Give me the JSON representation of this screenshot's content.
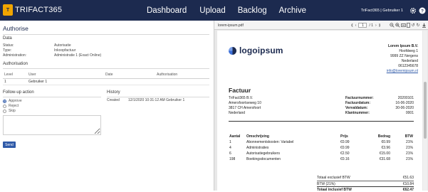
{
  "app": {
    "logo_badge": "T",
    "logo_text": "TRIFACT365"
  },
  "nav": {
    "items": [
      {
        "label": "Dashboard"
      },
      {
        "label": "Upload"
      },
      {
        "label": "Backlog"
      },
      {
        "label": "Archive"
      }
    ]
  },
  "user": {
    "text": "TriFact365 | Gebruiker 1",
    "icons": [
      "gear-icon",
      "help-icon"
    ]
  },
  "page": {
    "title": "Authorise",
    "data_heading": "Data",
    "fields": [
      {
        "label": "Status:",
        "value": "Autorisatie"
      },
      {
        "label": "Type:",
        "value": "Inkoopfactuur"
      },
      {
        "label": "Administration:",
        "value": "Administratie 1 (Exact Online)"
      }
    ],
    "authorisation_heading": "Authorisation",
    "auth_table": {
      "headers": [
        "Level",
        "User",
        "Date",
        "Authorisation"
      ],
      "rows": [
        [
          "1",
          "Gebruiker 1",
          "",
          ""
        ]
      ]
    },
    "follow_up_heading": "Follow-up action",
    "options": [
      {
        "label": "Approve",
        "checked": true
      },
      {
        "label": "Reject",
        "checked": false
      },
      {
        "label": "Skip",
        "checked": false
      }
    ],
    "comment_value": "",
    "send_label": "Send",
    "history_heading": "History",
    "history": [
      {
        "status": "Created",
        "timestamp": "12/1/2020 10:31:12 AM Gebruiker 1"
      }
    ]
  },
  "viewer": {
    "file_name": "lorem-ipsum.pdf",
    "page_current": "1",
    "page_total": "/ 1",
    "nav_icons": [
      "first-page-icon",
      "prev-page-icon",
      "next-page-icon",
      "last-page-icon"
    ],
    "tool_icons": [
      "zoom-out-icon",
      "zoom-in-icon",
      "fit-width-icon",
      "fit-page-icon",
      "rotate-left-icon",
      "rotate-right-icon",
      "refresh-icon",
      "download-icon"
    ]
  },
  "invoice": {
    "logo_text": "logoipsum",
    "sender": {
      "name": "Lorem Ipsum B.V.",
      "street": "Hoofdweg 1",
      "city": "9999 ZZ Nergens",
      "country": "Nederland",
      "phone": "0612345678",
      "email": "info@loremipsum.nl"
    },
    "title": "Factuur",
    "recipient": {
      "name": "TriFact365 B.V.",
      "street": "Amersfoortseweg 10",
      "city": "3817 CH Amersfoort",
      "country": "Nederland"
    },
    "meta": [
      {
        "label": "Factuurnummer:",
        "value": "20200101"
      },
      {
        "label": "Factuurdatum:",
        "value": "16-06-2020"
      },
      {
        "label": "Vervaldatum:",
        "value": "30-06-2020"
      },
      {
        "label": "Klantnummer:",
        "value": "0001"
      }
    ],
    "lines_headers": [
      "Aantal",
      "Omschrijving",
      "Prijs",
      "Bedrag",
      "BTW"
    ],
    "lines": [
      [
        "1",
        "Abonnementskosten: Variabel",
        "€0.99",
        "€0.99",
        "21%"
      ],
      [
        "4",
        "Administraties",
        "€0.99",
        "€3.96",
        "21%"
      ],
      [
        "6",
        "Autorisatiegebruikers",
        "€2.50",
        "€15.00",
        "21%"
      ],
      [
        "198",
        "Boekingsdocumenten",
        "€0.16",
        "€31.68",
        "21%"
      ]
    ],
    "totals": [
      {
        "label": "Totaal exclusief BTW",
        "value": "€51.63"
      },
      {
        "label": "BTW (21%)",
        "value": "€10.84"
      },
      {
        "label": "Totaal inclusief BTW",
        "value": "€62.47"
      }
    ]
  }
}
